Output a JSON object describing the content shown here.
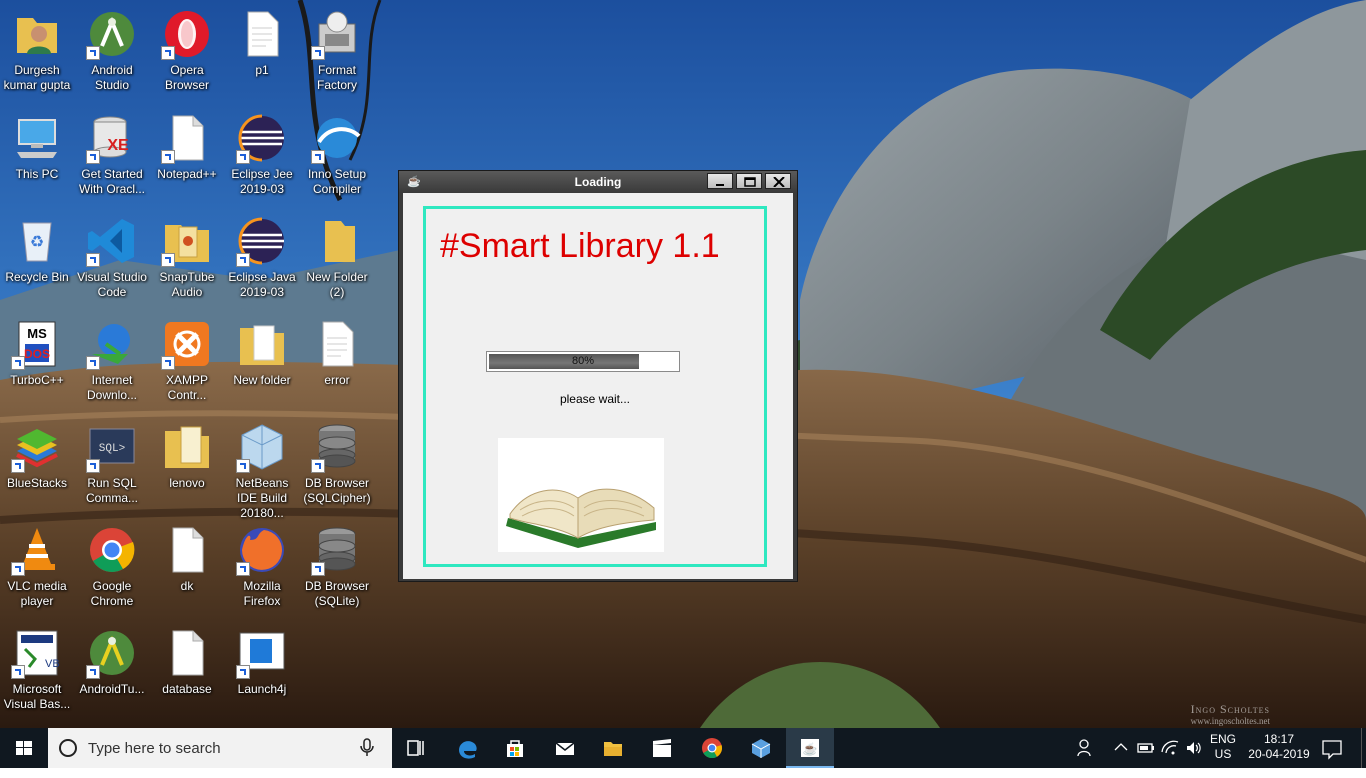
{
  "desktop": {
    "icons": [
      {
        "label": "Durgesh kumar gupta",
        "icon": "user-folder-icon"
      },
      {
        "label": "Android Studio",
        "icon": "android-studio-icon"
      },
      {
        "label": "Opera Browser",
        "icon": "opera-icon"
      },
      {
        "label": "p1",
        "icon": "document-icon"
      },
      {
        "label": "Format Factory",
        "icon": "format-factory-icon"
      },
      {
        "label": "This PC",
        "icon": "computer-icon"
      },
      {
        "label": "Get Started With Oracl...",
        "icon": "oracle-xe-icon"
      },
      {
        "label": "Notepad++",
        "icon": "document-icon"
      },
      {
        "label": "Eclipse Jee 2019-03",
        "icon": "eclipse-icon"
      },
      {
        "label": "Inno Setup Compiler",
        "icon": "inno-setup-icon"
      },
      {
        "label": "Recycle Bin",
        "icon": "recycle-bin-icon"
      },
      {
        "label": "Visual Studio Code",
        "icon": "vscode-icon"
      },
      {
        "label": "SnapTube Audio",
        "icon": "folder-icon"
      },
      {
        "label": "Eclipse Java 2019-03",
        "icon": "eclipse-icon"
      },
      {
        "label": "New Folder (2)",
        "icon": "folder-icon"
      },
      {
        "label": "TurboC++",
        "icon": "turboc-icon"
      },
      {
        "label": "Internet Downlo...",
        "icon": "idm-icon"
      },
      {
        "label": "XAMPP Contr...",
        "icon": "xampp-icon"
      },
      {
        "label": "New folder",
        "icon": "folder-icon"
      },
      {
        "label": "error",
        "icon": "document-icon"
      },
      {
        "label": "BlueStacks",
        "icon": "bluestacks-icon"
      },
      {
        "label": "Run SQL Comma...",
        "icon": "sql-icon"
      },
      {
        "label": "lenovo",
        "icon": "folder-icon"
      },
      {
        "label": "NetBeans IDE Build 20180...",
        "icon": "netbeans-icon"
      },
      {
        "label": "DB Browser (SQLCipher)",
        "icon": "database-icon"
      },
      {
        "label": "VLC media player",
        "icon": "vlc-icon"
      },
      {
        "label": "Google Chrome",
        "icon": "chrome-icon"
      },
      {
        "label": "dk",
        "icon": "document-icon"
      },
      {
        "label": "Mozilla Firefox",
        "icon": "firefox-icon"
      },
      {
        "label": "DB Browser (SQLite)",
        "icon": "database-icon"
      },
      {
        "label": "Microsoft Visual Bas...",
        "icon": "vb-icon"
      },
      {
        "label": "AndroidTu...",
        "icon": "android-studio-icon"
      },
      {
        "label": "database",
        "icon": "document-icon"
      },
      {
        "label": "Launch4j",
        "icon": "launch4j-icon"
      }
    ],
    "watermark": {
      "name": "Ingo Scholtes",
      "url": "www.ingoscholtes.net"
    }
  },
  "window": {
    "title": "Loading",
    "app_title": "#Smart Library 1.1",
    "progress": {
      "value": 0.8,
      "text": "80%"
    },
    "status": "please wait...",
    "colors": {
      "title": "#dd0000",
      "border": "#2ee8c0"
    }
  },
  "taskbar": {
    "search_placeholder": "Type here to search",
    "apps": [
      "task-view-icon",
      "edge-icon",
      "store-icon",
      "mail-icon",
      "file-explorer-icon",
      "movies-icon",
      "chrome-icon",
      "virtualbox-icon",
      "java-icon"
    ],
    "lang_top": "ENG",
    "lang_bottom": "US",
    "time": "18:17",
    "date": "20-04-2019"
  }
}
